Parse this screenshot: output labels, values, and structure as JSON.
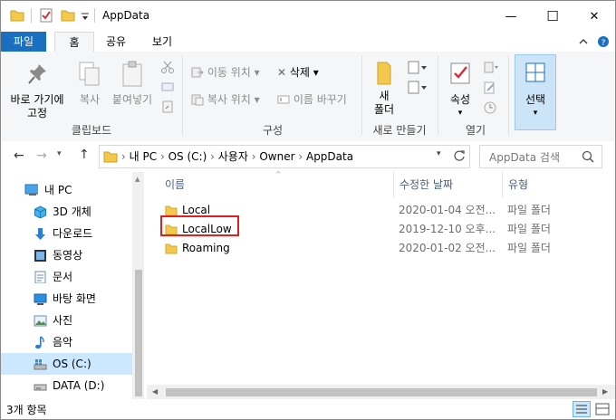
{
  "window": {
    "title": "AppData",
    "controls": {
      "minimize": "—",
      "maximize": "☐",
      "close": "✕"
    }
  },
  "tabs": [
    {
      "label": "파일"
    },
    {
      "label": "홈"
    },
    {
      "label": "공유"
    },
    {
      "label": "보기"
    }
  ],
  "ribbon": {
    "pin": "바로 가기에\n고정",
    "copy": "복사",
    "paste": "붙여넣기",
    "clipboard_group": "클립보드",
    "move_to": "이동 위치",
    "copy_to": "복사 위치",
    "delete": "삭제",
    "rename": "이름 바꾸기",
    "organize_group": "구성",
    "new_folder": "새\n폴더",
    "new_group": "새로 만들기",
    "properties": "속성",
    "open_group": "열기",
    "select": "선택"
  },
  "address": {
    "crumbs": [
      "내 PC",
      "OS (C:)",
      "사용자",
      "Owner",
      "AppData"
    ],
    "search_placeholder": "AppData 검색"
  },
  "sidebar": {
    "items": [
      {
        "label": "내 PC",
        "icon": "pc-icon"
      },
      {
        "label": "3D 개체",
        "icon": "3d-objects-icon"
      },
      {
        "label": "다운로드",
        "icon": "download-icon"
      },
      {
        "label": "동영상",
        "icon": "video-icon"
      },
      {
        "label": "문서",
        "icon": "document-icon"
      },
      {
        "label": "바탕 화면",
        "icon": "desktop-icon"
      },
      {
        "label": "사진",
        "icon": "pictures-icon"
      },
      {
        "label": "음악",
        "icon": "music-icon"
      },
      {
        "label": "OS (C:)",
        "icon": "drive-icon"
      },
      {
        "label": "DATA (D:)",
        "icon": "drive-icon"
      }
    ]
  },
  "list": {
    "columns": [
      "이름",
      "수정한 날짜",
      "유형"
    ],
    "rows": [
      {
        "name": "Local",
        "date": "2020-01-04 오전...",
        "type": "파일 폴더"
      },
      {
        "name": "LocalLow",
        "date": "2019-12-10 오후...",
        "type": "파일 폴더"
      },
      {
        "name": "Roaming",
        "date": "2020-01-02 오전...",
        "type": "파일 폴더"
      }
    ]
  },
  "status": {
    "count": "3개 항목"
  },
  "colors": {
    "accent": "#1a6fc0",
    "folder": "#f2c94c",
    "highlight": "#e02020",
    "selected": "#cce8ff"
  }
}
